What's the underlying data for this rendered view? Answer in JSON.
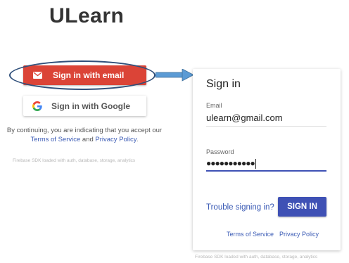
{
  "app": {
    "title": "ULearn"
  },
  "auth_picker": {
    "email_button_label": "Sign in with email",
    "google_button_label": "Sign in with Google",
    "tos_prefix": "By continuing, you are indicating that you accept our",
    "tos_link": "Terms of Service",
    "tos_and": "and",
    "privacy_link": "Privacy Policy",
    "tos_suffix": ".",
    "sdk_note": "Firebase SDK loaded with auth, database, storage, analytics"
  },
  "sign_in_card": {
    "title": "Sign in",
    "email_label": "Email",
    "email_value": "ulearn@gmail.com",
    "password_label": "Password",
    "password_value": "●●●●●●●●●●●",
    "trouble_link": "Trouble signing in?",
    "submit_label": "SIGN IN",
    "footer_tos": "Terms of Service",
    "footer_privacy": "Privacy Policy",
    "sdk_note": "Firebase SDK loaded with auth, database, storage, analytics"
  },
  "colors": {
    "email_button": "#db4437",
    "primary": "#3f51b5",
    "link": "#3b5bb5",
    "callout": "#2f4f7a",
    "arrow": "#5b9bd5"
  },
  "icons": {
    "email_button": "mail-icon",
    "google_button": "google-g-icon",
    "callout": "arrow-right-icon"
  }
}
